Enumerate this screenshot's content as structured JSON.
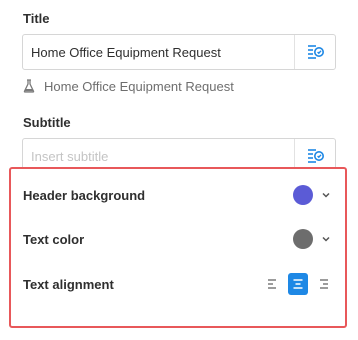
{
  "title_section": {
    "label": "Title",
    "value": "Home Office Equipment Request",
    "variable_icon": "variable-insert-icon",
    "preview_icon": "flask-icon",
    "preview_text": "Home Office Equipment Request"
  },
  "subtitle_section": {
    "label": "Subtitle",
    "value": "",
    "placeholder": "Insert subtitle",
    "variable_icon": "variable-insert-icon"
  },
  "appearance": {
    "header_background": {
      "label": "Header background",
      "color": "#5b5bd6"
    },
    "text_color": {
      "label": "Text color",
      "color": "#6d6d6d"
    },
    "text_alignment": {
      "label": "Text alignment",
      "options": [
        "left",
        "center",
        "right"
      ],
      "selected": "center"
    }
  },
  "colors": {
    "accent": "#1e88e5",
    "highlight_border": "#e8585a"
  }
}
